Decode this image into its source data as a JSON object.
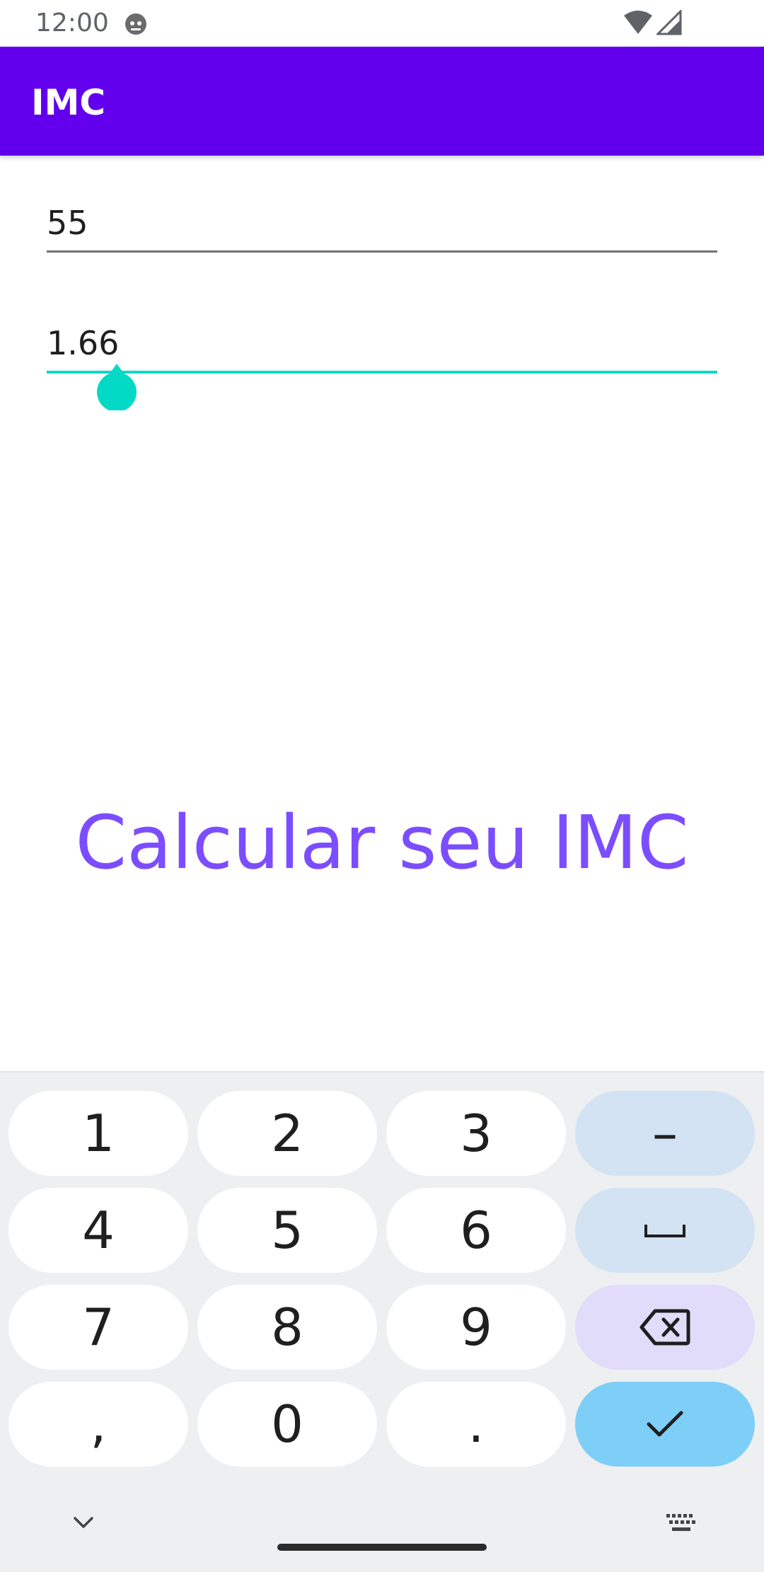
{
  "status_bar": {
    "time": "12:00",
    "icons": [
      "face-icon",
      "wifi-icon",
      "signal-icon"
    ]
  },
  "app_bar": {
    "title": "IMC"
  },
  "form": {
    "weight_value": "55",
    "height_value": "1.66"
  },
  "actions": {
    "calculate_label": "Calcular seu IMC"
  },
  "keyboard": {
    "rows": [
      [
        "1",
        "2",
        "3",
        "–"
      ],
      [
        "4",
        "5",
        "6",
        "space-icon"
      ],
      [
        "7",
        "8",
        "9",
        "backspace-icon"
      ],
      [
        ",",
        "0",
        ".",
        "check-icon"
      ]
    ],
    "labels": {
      "k1": "1",
      "k2": "2",
      "k3": "3",
      "minus": "–",
      "k4": "4",
      "k5": "5",
      "k6": "6",
      "k7": "7",
      "k8": "8",
      "k9": "9",
      "comma": ",",
      "k0": "0",
      "period": "."
    },
    "icons": [
      "chevron-down-icon",
      "keyboard-icon"
    ]
  },
  "colors": {
    "app_bar": "#6200ee",
    "accent": "#03dac5",
    "button_text": "#7c4dff",
    "enter_key": "#7dcff8"
  }
}
